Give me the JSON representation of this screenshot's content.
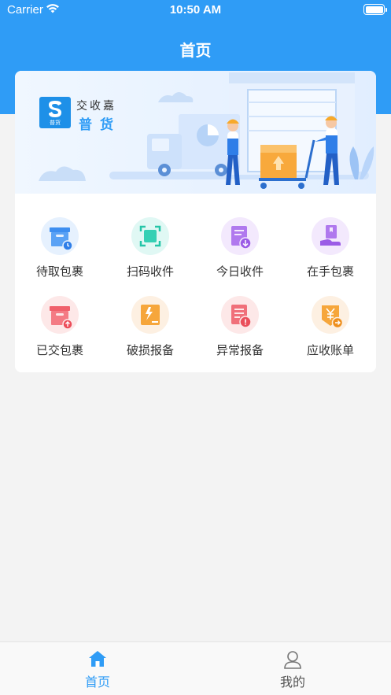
{
  "status_bar": {
    "carrier": "Carrier",
    "time": "10:50 AM"
  },
  "nav": {
    "title": "首页"
  },
  "banner": {
    "brand_line1": "交收嘉",
    "brand_line2": "普货",
    "logo_sub": "普货"
  },
  "colors": {
    "primary": "#2f9cf6",
    "page_bg": "#f3f3f3",
    "card_bg": "#ffffff"
  },
  "grid": [
    {
      "label": "待取包裹",
      "icon": "package-clock-icon"
    },
    {
      "label": "扫码收件",
      "icon": "scan-icon"
    },
    {
      "label": "今日收件",
      "icon": "document-download-icon"
    },
    {
      "label": "在手包裹",
      "icon": "hand-package-icon"
    },
    {
      "label": "已交包裹",
      "icon": "package-upload-icon"
    },
    {
      "label": "破损报备",
      "icon": "broken-box-icon"
    },
    {
      "label": "异常报备",
      "icon": "document-alert-icon"
    },
    {
      "label": "应收账单",
      "icon": "yen-bill-icon"
    }
  ],
  "tabbar": [
    {
      "label": "首页",
      "icon": "home-icon",
      "active": true
    },
    {
      "label": "我的",
      "icon": "user-icon",
      "active": false
    }
  ]
}
